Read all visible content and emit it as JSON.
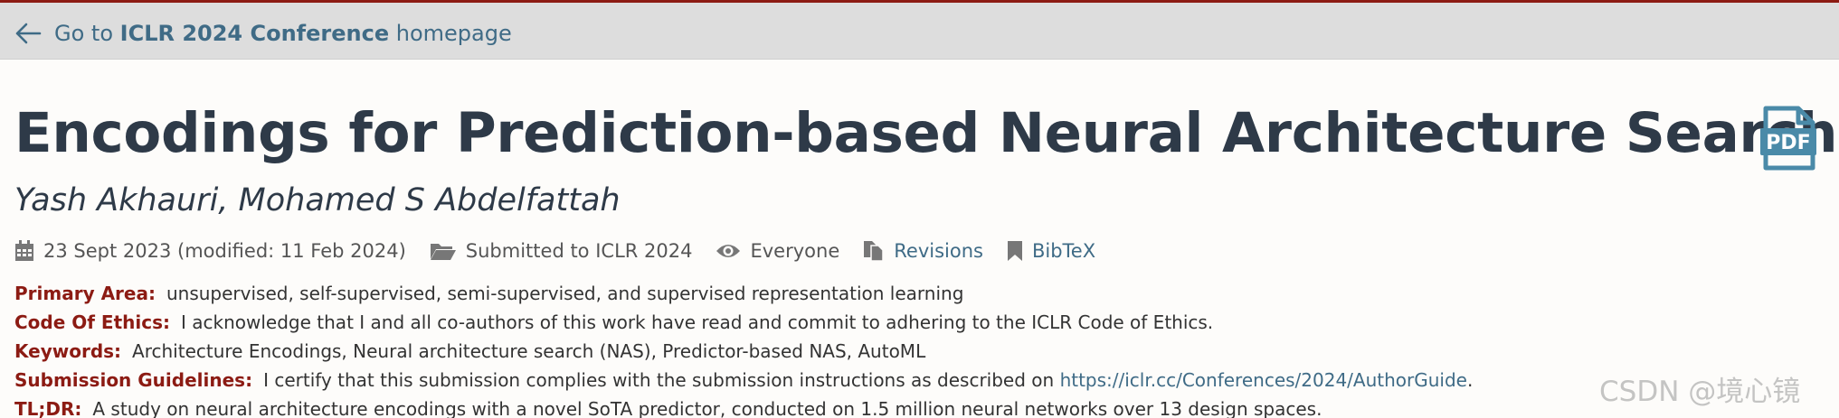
{
  "nav": {
    "back_prefix": "Go to ",
    "back_conference": "ICLR 2024 Conference",
    "back_suffix": " homepage"
  },
  "paper": {
    "title": "Encodings for Prediction-based Neural Architecture Search",
    "authors": "Yash Akhauri, Mohamed S Abdelfattah",
    "pdf_label": "PDF"
  },
  "meta": {
    "date": "23 Sept 2023 (modified: 11 Feb 2024)",
    "venue": "Submitted to ICLR 2024",
    "readers": "Everyone",
    "revisions": "Revisions",
    "bibtex": "BibTeX"
  },
  "fields": {
    "primary_area_label": "Primary Area:",
    "primary_area_value": "unsupervised, self-supervised, semi-supervised, and supervised representation learning",
    "ethics_label": "Code Of Ethics:",
    "ethics_value": "I acknowledge that I and all co-authors of this work have read and commit to adhering to the ICLR Code of Ethics.",
    "keywords_label": "Keywords:",
    "keywords_value": "Architecture Encodings, Neural architecture search (NAS), Predictor-based NAS, AutoML",
    "guidelines_label": "Submission Guidelines:",
    "guidelines_value": "I certify that this submission complies with the submission instructions as described on",
    "guidelines_link": "https://iclr.cc/Conferences/2024/AuthorGuide",
    "guidelines_end": ".",
    "tldr_label": "TL;DR:",
    "tldr_value": "A study on neural architecture encodings with a novel SoTA predictor, conducted on 1.5 million neural networks over 13 design spaces."
  },
  "watermark": "CSDN @境心镜",
  "colors": {
    "label_red": "#8c1b13",
    "link_blue": "#3f6b86",
    "title_dark": "#2e3a48",
    "topbar_bg": "#dddddd"
  }
}
